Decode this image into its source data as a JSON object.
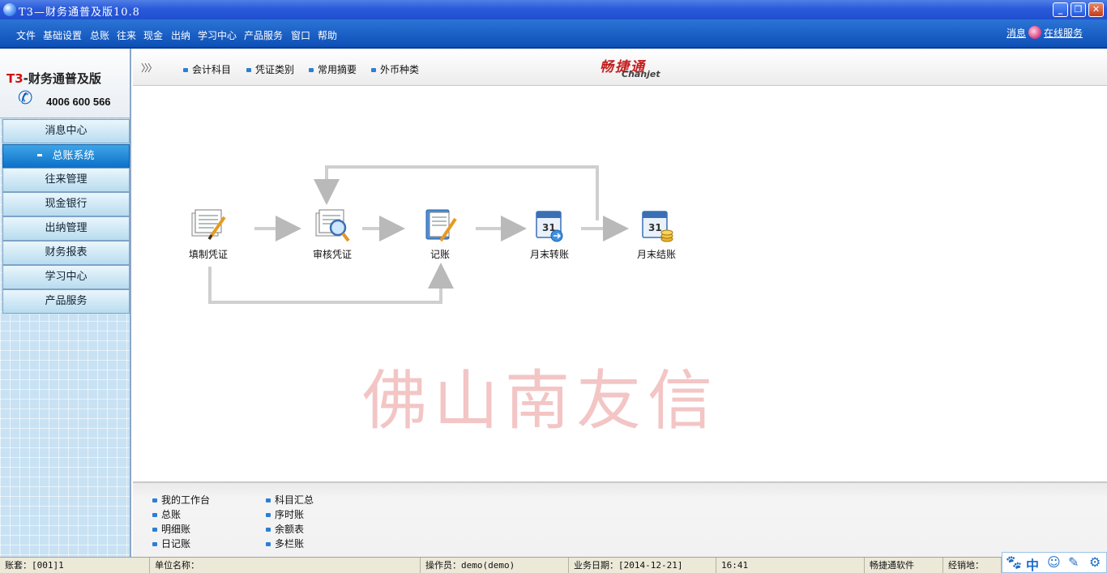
{
  "window": {
    "title": "T3—财务通普及版10.8",
    "controls": [
      "minimize-icon",
      "restore-icon",
      "close-icon"
    ]
  },
  "menu": {
    "items": [
      "文件",
      "基础设置",
      "总账",
      "往来",
      "现金",
      "出纳",
      "学习中心",
      "产品服务",
      "窗口",
      "帮助"
    ],
    "messages": "消息",
    "online_service": "在线服务"
  },
  "brand": {
    "prefix": "T3",
    "name": "-财务通普及版",
    "phone": "4006 600 566"
  },
  "sidebar": {
    "items": [
      {
        "label": "消息中心",
        "active": false
      },
      {
        "label": "总账系统",
        "active": true
      },
      {
        "label": "往来管理",
        "active": false
      },
      {
        "label": "现金银行",
        "active": false
      },
      {
        "label": "出纳管理",
        "active": false
      },
      {
        "label": "财务报表",
        "active": false
      },
      {
        "label": "学习中心",
        "active": false
      },
      {
        "label": "产品服务",
        "active": false
      }
    ]
  },
  "topnav": {
    "links": [
      "会计科目",
      "凭证类别",
      "常用摘要",
      "外币种类"
    ],
    "logo_cn": "畅捷通",
    "logo_en": "Chanjet"
  },
  "flow": {
    "nodes": [
      {
        "label": "填制凭证",
        "icon": "fill-voucher-icon"
      },
      {
        "label": "审核凭证",
        "icon": "audit-voucher-icon"
      },
      {
        "label": "记账",
        "icon": "post-ledger-icon"
      },
      {
        "label": "月末转账",
        "icon": "month-end-transfer-icon"
      },
      {
        "label": "月末结账",
        "icon": "month-end-close-icon"
      }
    ]
  },
  "watermark": "佛山南友信",
  "bottom_links": {
    "col1": [
      "我的工作台",
      "总账",
      "明细账",
      "日记账"
    ],
    "col2": [
      "科目汇总",
      "序时账",
      "余额表",
      "多栏账"
    ]
  },
  "status": {
    "account": "账套：[001]1",
    "company": "单位名称：",
    "operator": "操作员：demo(demo)",
    "business_date": "业务日期：[2014-12-21]",
    "time": "16:41",
    "vendor": "畅捷通软件",
    "dealer": "经销地："
  },
  "ime": [
    "paw-icon",
    "中",
    "smile-icon",
    "pen-icon",
    "gear-icon"
  ],
  "colors": {
    "title_bar": "#2a5ad9",
    "menu_bar": "#0d4fb6",
    "active_nav": "#0b70c7",
    "watermark": "#dc5a5a",
    "brand_red": "#d01010"
  }
}
